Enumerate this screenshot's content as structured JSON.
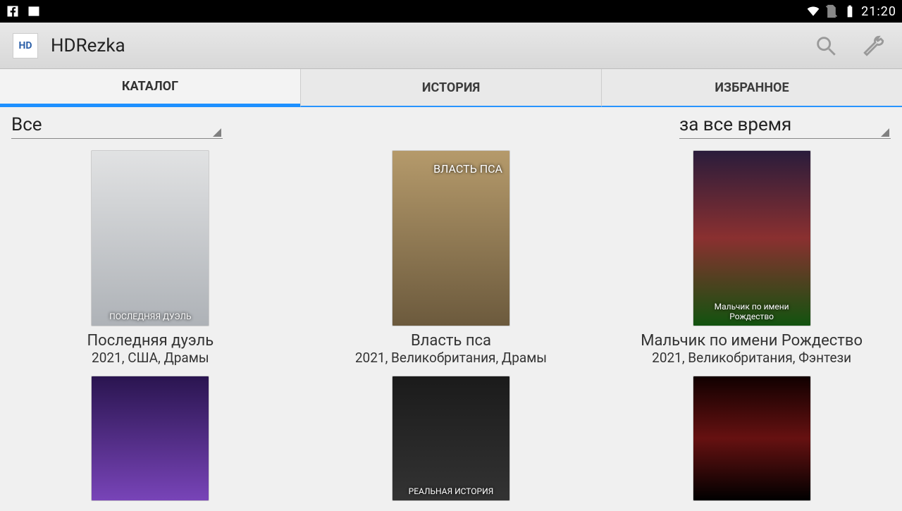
{
  "statusbar": {
    "time": "21:20"
  },
  "appbar": {
    "logo_text": "HD",
    "title": "HDRezka"
  },
  "tabs": {
    "items": [
      {
        "label": "КАТАЛОГ",
        "active": true
      },
      {
        "label": "ИСТОРИЯ",
        "active": false
      },
      {
        "label": "ИЗБРАННОЕ",
        "active": false
      }
    ]
  },
  "filters": {
    "category": "Все",
    "period": "за все время"
  },
  "movies": [
    {
      "title": "Последняя дуэль",
      "meta": "2021, США, Драмы",
      "poster_text": "ПОСЛЕДНЯЯ ДУЭЛЬ",
      "theme": "p0"
    },
    {
      "title": "Власть пса",
      "meta": "2021, Великобритания, Драмы",
      "poster_text": "ВЛАСТЬ ПСА",
      "theme": "p1"
    },
    {
      "title": "Мальчик по имени Рождество",
      "meta": "2021, Великобритания, Фэнтези",
      "poster_text": "Мальчик по имени Рождество",
      "theme": "p2"
    },
    {
      "title": "",
      "meta": "",
      "poster_text": "",
      "theme": "p3",
      "partial": true
    },
    {
      "title": "",
      "meta": "",
      "poster_text": "РЕАЛЬНАЯ ИСТОРИЯ",
      "theme": "p4",
      "partial": true
    },
    {
      "title": "",
      "meta": "",
      "poster_text": "",
      "theme": "p5",
      "partial": true
    }
  ]
}
